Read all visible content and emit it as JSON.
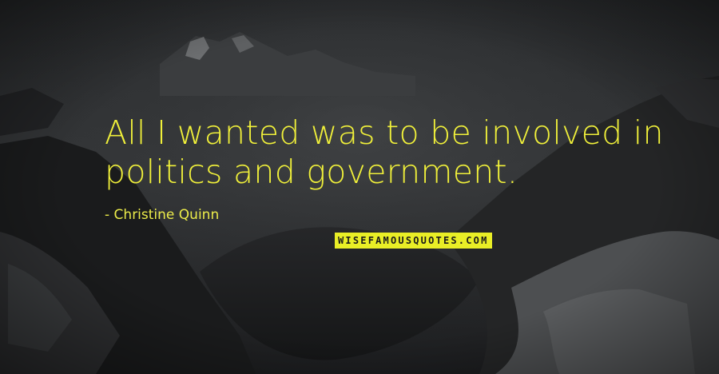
{
  "quote": {
    "text": "All I wanted was to be involved in politics and government.",
    "author": "Christine Quinn"
  },
  "brand": {
    "logo_text": "WISEFAMOUSQUOTES.COM"
  },
  "colors": {
    "quote_text": "#f0f03a",
    "brand_background": "#e9ee26",
    "background": "#1e1f21"
  }
}
